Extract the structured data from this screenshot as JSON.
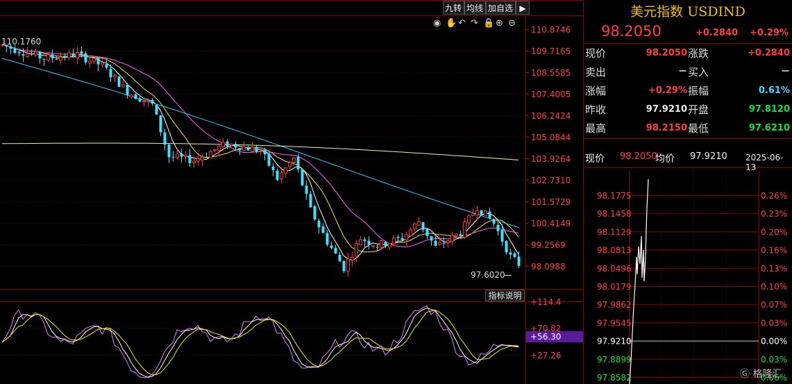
{
  "toolbar": {
    "nine": "九转",
    "ma": "均线",
    "watch": "加自选",
    "arrow": "▶"
  },
  "chart_icons": [
    "eye-icon",
    "hand-icon",
    "undo-icon",
    "redo-icon",
    "lock-icon",
    "zoom-in-icon",
    "zoom-out-icon"
  ],
  "indicator_button": "指标说明",
  "main_chart": {
    "y_ticks": [
      "110.8746",
      "109.7165",
      "108.5585",
      "107.4005",
      "106.2424",
      "105.0844",
      "103.9264",
      "102.7310",
      "101.5729",
      "100.4149",
      "99.2569",
      "98.0988"
    ],
    "max_label": "110.1760",
    "min_label": "97.6020",
    "colors": {
      "up": "#ff3030",
      "down": "#40e0ff",
      "ma5": "#ffffff",
      "ma10": "#ffe040",
      "ma20": "#ff60ff",
      "ma60": "#30c8ff",
      "ma250": "#f0f0b0"
    }
  },
  "indicator": {
    "y_ticks": [
      "+114.4",
      "+70.82",
      "+27.26"
    ],
    "current": "+56.30"
  },
  "quote": {
    "title": "美元指数 USDIND",
    "price": "98.2050",
    "change": "+0.2840",
    "change_pct": "+0.29%",
    "rows": [
      {
        "l1": "现价",
        "v1": "98.2050",
        "c1": "red",
        "l2": "涨跌",
        "v2": "+0.2840",
        "c2": "red"
      },
      {
        "l1": "卖出",
        "v1": "－",
        "c1": "white",
        "l2": "买入",
        "v2": "－",
        "c2": "white"
      },
      {
        "l1": "涨幅",
        "v1": "+0.29%",
        "c1": "red",
        "l2": "振幅",
        "v2": "0.61%",
        "c2": "cyan"
      },
      {
        "l1": "昨收",
        "v1": "97.9210",
        "c1": "white",
        "l2": "开盘",
        "v2": "97.8120",
        "c2": "green"
      },
      {
        "l1": "最高",
        "v1": "98.2150",
        "c1": "red",
        "l2": "最低",
        "v2": "97.6210",
        "c2": "green"
      }
    ]
  },
  "intraday": {
    "now_label": "现价",
    "now_value": "98.2050",
    "avg_label": "均价",
    "avg_value": "97.9210",
    "date": "2025-06-13",
    "left_ticks": [
      "98.1775",
      "98.1458",
      "98.1129",
      "98.0813",
      "98.0496",
      "98.0179",
      "97.9862",
      "97.9545",
      "97.9210",
      "97.8899",
      "97.8582"
    ],
    "right_ticks": [
      "0.26%",
      "0.23%",
      "0.20%",
      "0.16%",
      "0.13%",
      "0.10%",
      "0.07%",
      "0.03%",
      "0.00%",
      "0.03%",
      "0.06%"
    ]
  },
  "watermark": "格隆汇"
}
